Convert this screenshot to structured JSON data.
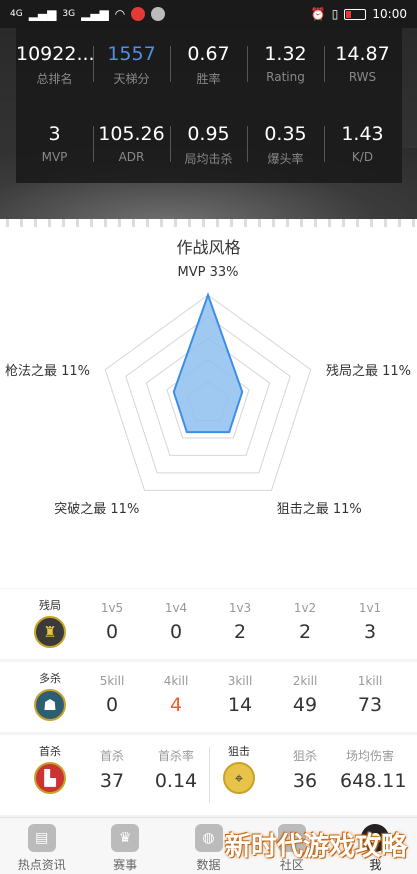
{
  "status_bar": {
    "signal_1": "4G",
    "signal_2": "3G",
    "time": "10:00"
  },
  "summary": {
    "row1": [
      {
        "value": "10922...",
        "label": "总排名"
      },
      {
        "value": "1557",
        "label": "天梯分"
      },
      {
        "value": "0.67",
        "label": "胜率"
      },
      {
        "value": "1.32",
        "label": "Rating"
      },
      {
        "value": "14.87",
        "label": "RWS"
      }
    ],
    "row2": [
      {
        "value": "3",
        "label": "MVP"
      },
      {
        "value": "105.26",
        "label": "ADR"
      },
      {
        "value": "0.95",
        "label": "局均击杀"
      },
      {
        "value": "0.35",
        "label": "爆头率"
      },
      {
        "value": "1.43",
        "label": "K/D"
      }
    ]
  },
  "style_title": "作战风格",
  "chart_data": {
    "type": "radar",
    "axes": [
      "MVP",
      "残局之最",
      "狙击之最",
      "突破之最",
      "枪法之最"
    ],
    "labels": [
      "MVP 33%",
      "残局之最 11%",
      "狙击之最 11%",
      "突破之最 11%",
      "枪法之最 11%"
    ],
    "values": [
      33,
      11,
      11,
      11,
      11
    ],
    "max": 33,
    "rings": 5,
    "colors": {
      "fill": "#8fc0f0",
      "stroke": "#3d8fe6",
      "grid": "#d6d6d6"
    }
  },
  "clutch": {
    "title": "残局",
    "icon": "soldier-icon",
    "columns": [
      {
        "key": "1v5",
        "value": "0"
      },
      {
        "key": "1v4",
        "value": "0"
      },
      {
        "key": "1v3",
        "value": "2"
      },
      {
        "key": "1v2",
        "value": "2"
      },
      {
        "key": "1v1",
        "value": "3"
      }
    ]
  },
  "multikill": {
    "title": "多杀",
    "icon": "group-icon",
    "columns": [
      {
        "key": "5kill",
        "value": "0"
      },
      {
        "key": "4kill",
        "value": "4"
      },
      {
        "key": "3kill",
        "value": "14"
      },
      {
        "key": "2kill",
        "value": "49"
      },
      {
        "key": "1kill",
        "value": "73"
      }
    ]
  },
  "first_kill": {
    "title": "首杀",
    "icon": "podium-icon",
    "columns": [
      {
        "key": "首杀",
        "value": "37"
      },
      {
        "key": "首杀率",
        "value": "0.14"
      }
    ]
  },
  "sniper": {
    "title": "狙击",
    "icon": "crosshair-icon",
    "columns": [
      {
        "key": "狙杀",
        "value": "36"
      },
      {
        "key": "场均伤害",
        "value": "648.11"
      }
    ]
  },
  "tabs": [
    {
      "label": "热点资讯",
      "icon": "news-icon"
    },
    {
      "label": "赛事",
      "icon": "trophy-icon"
    },
    {
      "label": "数据",
      "icon": "basketball-icon"
    },
    {
      "label": "社区",
      "icon": "chat-icon"
    },
    {
      "label": "我",
      "icon": "profile-icon"
    }
  ],
  "watermark": "新时代游戏攻略"
}
